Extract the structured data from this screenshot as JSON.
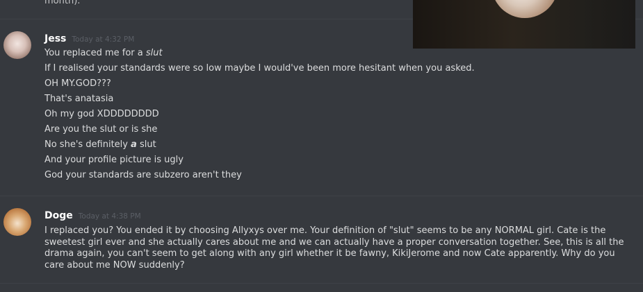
{
  "top_fragment": "month).",
  "messages": [
    {
      "username": "Jess",
      "timestamp": "Today at 4:32 PM",
      "lines": [
        {
          "pre": "You replaced me for a ",
          "em": "slut",
          "post": ""
        },
        {
          "text": "If I realised your standards were so low maybe I would've been more hesitant when you asked."
        },
        {
          "text": "OH MY.GOD???"
        },
        {
          "text": "That's anatasia"
        },
        {
          "text": "Oh my god XDDDDDDDD"
        },
        {
          "text": "Are you the slut or is she"
        },
        {
          "pre": "No she's definitely ",
          "strong": "a",
          "post": " slut"
        },
        {
          "text": "And your profile picture is ugly"
        },
        {
          "text": "God your standards are subzero aren't they"
        }
      ]
    },
    {
      "username": "Doge",
      "timestamp": "Today at 4:38 PM",
      "text": "I replaced you? You ended it by choosing Allyxys over me. Your definition of \"slut\" seems to be any NORMAL girl. Cate is the sweetest girl ever and she actually cares about me and we can actually have a proper conversation together. See, this is all the drama again, you can't seem to get along with any girl whether it be fawny, KikiJerome and now Cate apparently. Why do you care about me NOW suddenly?"
    }
  ]
}
